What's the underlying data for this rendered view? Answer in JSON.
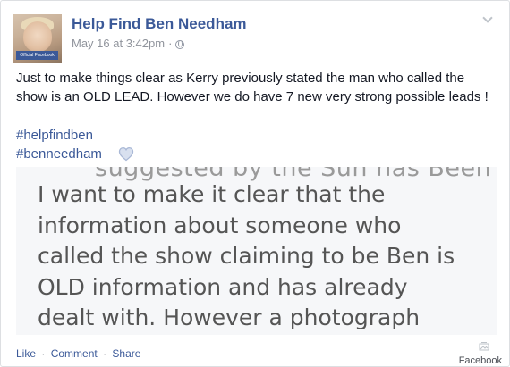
{
  "post": {
    "page_name": "Help Find Ben Needham",
    "avatar_badge": "Official Facebook",
    "timestamp": "May 16 at 3:42pm",
    "meta_dot": "·",
    "text": "Just to make things clear as Kerry previously stated the man who called the show is an OLD LEAD. However we do have 7 new very strong possible leads !",
    "hashtags": [
      "#helpfindben",
      "#benneedham"
    ]
  },
  "attached_image": {
    "cutoff_text": "suggested by the Sun has Been",
    "lines": [
      "I want to make it clear that the",
      "information about someone who",
      "called the show claiming to be Ben is",
      "OLD information and has already",
      "dealt with. However a photograph"
    ]
  },
  "actions": {
    "like": "Like",
    "comment": "Comment",
    "share": "Share",
    "separator": "·"
  },
  "credit": "Facebook",
  "colors": {
    "link": "#3b5998",
    "meta": "#90949c",
    "text": "#141823",
    "heart": "#b4c3e0"
  },
  "icons": [
    "chevron-down-icon",
    "globe-icon",
    "heart-icon",
    "photo-icon"
  ]
}
